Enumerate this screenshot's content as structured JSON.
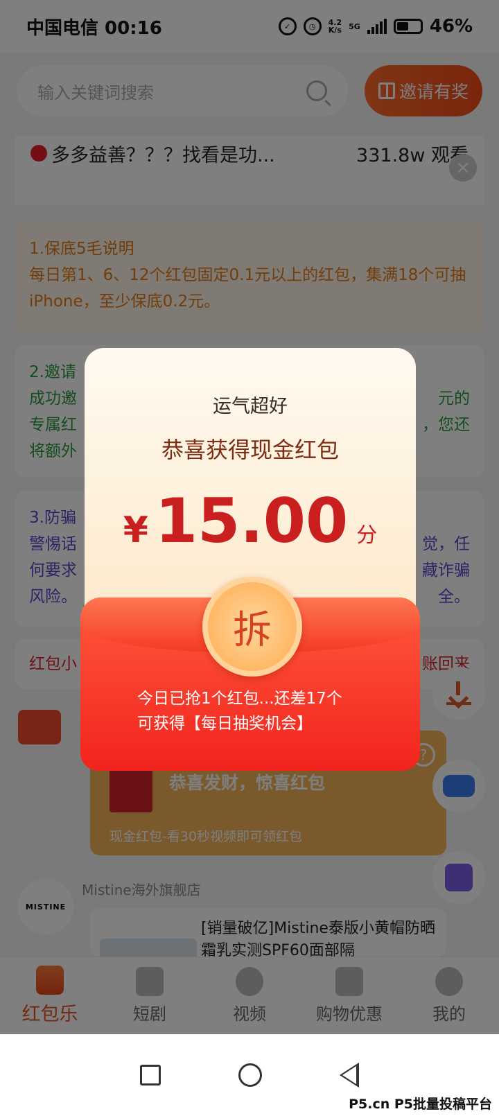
{
  "status": {
    "carrier_time": "中国电信 00:16",
    "net_speed": "4.2\nK/s",
    "network": "5G",
    "battery": "46%"
  },
  "search": {
    "placeholder": "输入关键词搜索"
  },
  "invite_button": "邀请有奖",
  "ticker": {
    "text": "多多益善？？？找看是功...",
    "views": "331.8w 观看",
    "close": "×"
  },
  "cards": {
    "guarantee": {
      "title": "1.保底5毛说明",
      "body": "每日第1、6、12个红包固定0.1元以上的红包，集满18个可抽iPhone，至少保底0.2元。"
    },
    "invite": {
      "line1": "2.邀请",
      "line2a": "成功邀",
      "line2b": "元的",
      "line3a": "专属红",
      "line3b": "，您还",
      "line4": "将额外"
    },
    "fraud": {
      "line1": "3.防骗",
      "line2a": "警惕话",
      "line2b": "觉，任",
      "line3a": "何要求",
      "line3b": "藏诈骗",
      "line4a": "风险。",
      "line4b": "全。"
    },
    "tip": {
      "left": "红包小",
      "right": "账回来"
    }
  },
  "chat": {
    "bubble_title": "恭喜发财，惊喜红包",
    "bubble_sub": "现金红包-看30秒视频即可领红包",
    "help": "?",
    "shop_logo": "MISTINE",
    "shop_name": "Mistine海外旗舰店",
    "shop_text": "[销量破亿]Mistine泰版小黄帽防晒霜乳实测SPF60面部隔"
  },
  "nav": [
    "红包乐",
    "短剧",
    "视频",
    "购物优惠",
    "我的"
  ],
  "modal": {
    "lucky": "运气超好",
    "congrats": "恭喜获得现金红包",
    "currency": "¥",
    "amount": "15.00",
    "unit": "分",
    "open": "拆",
    "note1": "今日已抢1个红包...还差17个",
    "note2": "可获得【每日抽奖机会】"
  },
  "watermark": "P5.cn P5批量投稿平台"
}
